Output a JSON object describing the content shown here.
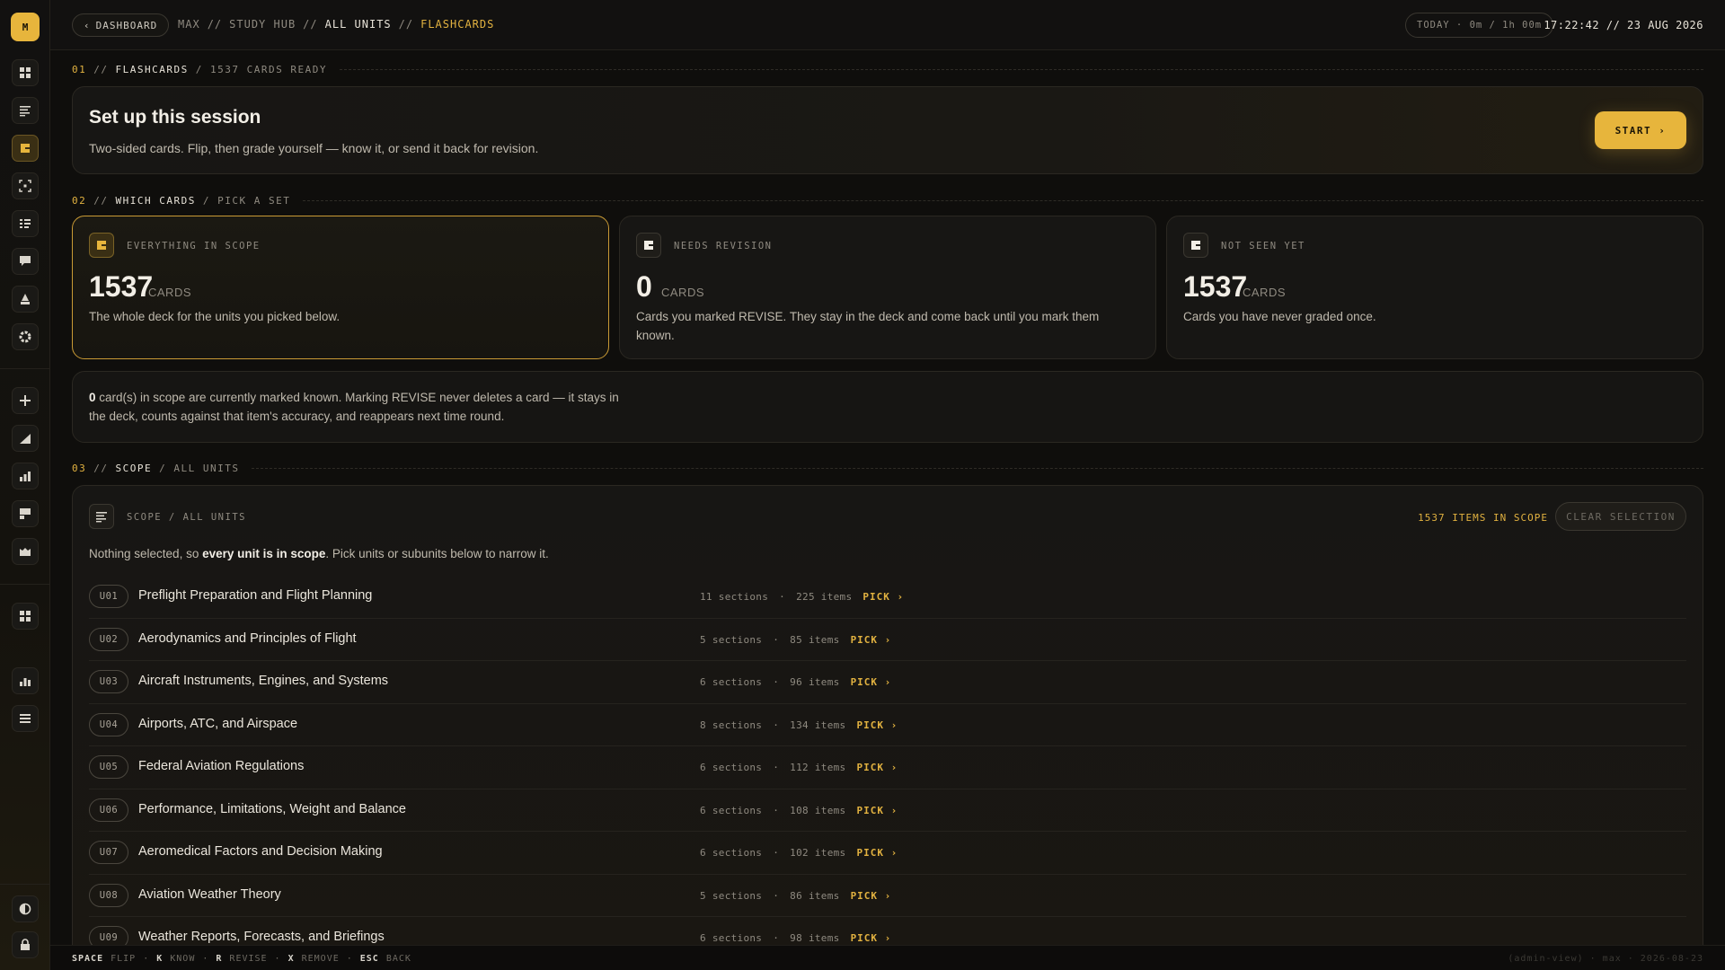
{
  "app": {
    "logo_letter": "M"
  },
  "sidebar": {
    "icons": [
      "dashboard-icon",
      "list-icon",
      "flashcards-icon",
      "focus-icon",
      "checklist-icon",
      "chat-icon",
      "exam-icon",
      "settings-icon",
      "add-icon",
      "progress-icon",
      "stats-icon",
      "notes-icon",
      "library-icon",
      "grid-icon",
      "analytics-icon",
      "menu-icon",
      "contrast-icon",
      "lock-icon"
    ],
    "active": "flashcards-icon"
  },
  "topbar": {
    "back_label": "DASHBOARD",
    "crumbs": [
      "MAX",
      "//",
      "STUDY HUB",
      "//",
      "ALL UNITS",
      "//",
      "FLASHCARDS"
    ],
    "today": "TODAY · 0m / 1h 00m",
    "clock": "17:22:42 // 23 AUG 2026"
  },
  "sections": {
    "s1": {
      "num": "01",
      "sep": "//",
      "title": "FLASHCARDS",
      "rest": "/ 1537 CARDS READY"
    },
    "s2": {
      "num": "02",
      "sep": "//",
      "title": "WHICH CARDS",
      "rest": "/ PICK A SET"
    },
    "s3": {
      "num": "03",
      "sep": "//",
      "title": "SCOPE",
      "rest": "/ ALL UNITS"
    }
  },
  "setup": {
    "title": "Set up this session",
    "subtitle": "Two-sided cards. Flip, then grade yourself — know it, or send it back for revision.",
    "start_label": "START ›"
  },
  "options": [
    {
      "label": "EVERYTHING IN SCOPE",
      "count": "1537",
      "unit": "CARDS",
      "desc": "The whole deck for the units you picked below.",
      "selected": true
    },
    {
      "label": "NEEDS REVISION",
      "count": "0",
      "unit": "CARDS",
      "desc": "Cards you marked REVISE. They stay in the deck and come back until you mark them known.",
      "selected": false
    },
    {
      "label": "NOT SEEN YET",
      "count": "1537",
      "unit": "CARDS",
      "desc": "Cards you have never graded once.",
      "selected": false
    }
  ],
  "note": {
    "count": "0",
    "text": " card(s) in scope are currently marked known. Marking REVISE never deletes a card — it stays in the deck, counts against that item's accuracy, and reappears next time round."
  },
  "scope": {
    "label": "SCOPE / ALL UNITS",
    "count": "1537 ITEMS IN SCOPE",
    "clear_label": "CLEAR SELECTION",
    "hint_pre": "Nothing selected, so ",
    "hint_bold": "every unit is in scope",
    "hint_post": ". Pick units or subunits below to narrow it.",
    "units": [
      {
        "code": "U01",
        "name": "Preflight Preparation and Flight Planning",
        "sections": "11 sections",
        "items": "225 items",
        "pick": "PICK ›"
      },
      {
        "code": "U02",
        "name": "Aerodynamics and Principles of Flight",
        "sections": "5 sections",
        "items": "85 items",
        "pick": "PICK ›"
      },
      {
        "code": "U03",
        "name": "Aircraft Instruments, Engines, and Systems",
        "sections": "6 sections",
        "items": "96 items",
        "pick": "PICK ›"
      },
      {
        "code": "U04",
        "name": "Airports, ATC, and Airspace",
        "sections": "8 sections",
        "items": "134 items",
        "pick": "PICK ›"
      },
      {
        "code": "U05",
        "name": "Federal Aviation Regulations",
        "sections": "6 sections",
        "items": "112 items",
        "pick": "PICK ›"
      },
      {
        "code": "U06",
        "name": "Performance, Limitations, Weight and Balance",
        "sections": "6 sections",
        "items": "108 items",
        "pick": "PICK ›"
      },
      {
        "code": "U07",
        "name": "Aeromedical Factors and Decision Making",
        "sections": "6 sections",
        "items": "102 items",
        "pick": "PICK ›"
      },
      {
        "code": "U08",
        "name": "Aviation Weather Theory",
        "sections": "5 sections",
        "items": "86 items",
        "pick": "PICK ›"
      },
      {
        "code": "U09",
        "name": "Weather Reports, Forecasts, and Briefings",
        "sections": "6 sections",
        "items": "98 items",
        "pick": "PICK ›"
      }
    ]
  },
  "keybar": {
    "keys": [
      {
        "key": "SPACE",
        "action": "FLIP"
      },
      {
        "key": "K",
        "action": "KNOW"
      },
      {
        "key": "R",
        "action": "REVISE"
      },
      {
        "key": "X",
        "action": "REMOVE"
      },
      {
        "key": "ESC",
        "action": "BACK"
      }
    ],
    "footer": "(admin-view) · max · 2026-08-23"
  },
  "colors": {
    "accent": "#e7b53c",
    "gold_text": "#e2b240",
    "bg": "#0f0e0c"
  }
}
